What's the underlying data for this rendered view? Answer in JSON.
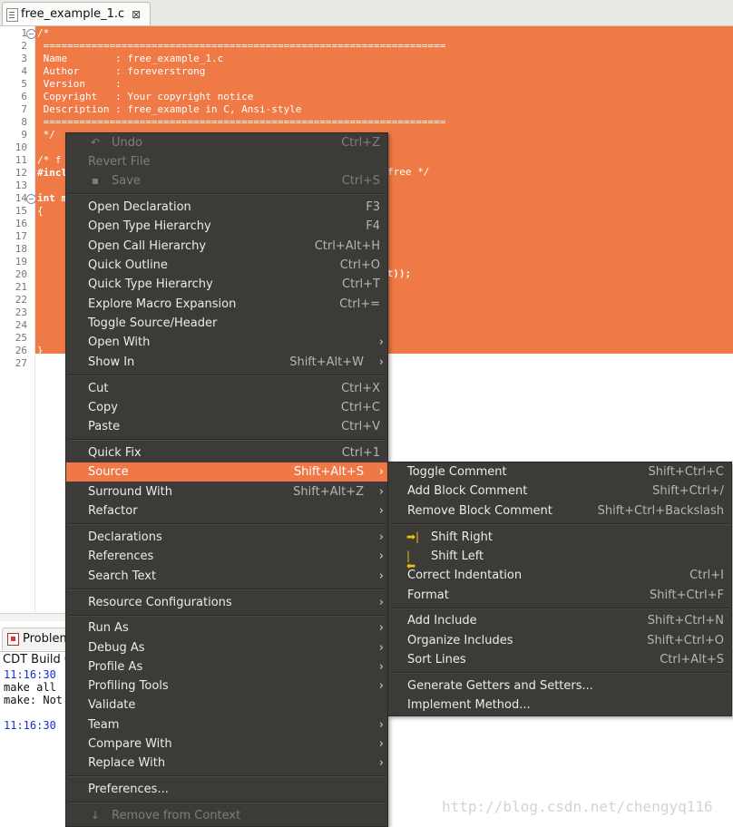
{
  "tab": {
    "title": "free_example_1.c",
    "close": "⊠"
  },
  "code": {
    "line_numbers": [
      "1",
      "2",
      "3",
      "4",
      "5",
      "6",
      "7",
      "8",
      "9",
      "10",
      "11",
      "12",
      "13",
      "14",
      "15",
      "16",
      "17",
      "18",
      "19",
      "20",
      "21",
      "22",
      "23",
      "24",
      "25",
      "26",
      "27"
    ],
    "lines": [
      "/*",
      " ===================================================================",
      " Name        : free_example_1.c",
      " Author      : foreverstrong",
      " Version     :",
      " Copyright   : Your copyright notice",
      " Description : free_example in C, Ansi-style",
      " ===================================================================",
      " */",
      "",
      "/* f",
      "#incl",
      "",
      "int m",
      "{",
      "",
      "",
      "",
      "",
      "",
      "",
      "",
      "",
      "",
      "",
      "}",
      ""
    ],
    "fragments": {
      "line12_tail": "free */",
      "line20_tail": "nt));"
    }
  },
  "problems": {
    "tab_label": "Problen",
    "header": "CDT Build C",
    "console": [
      "11:16:30",
      "make all",
      "make: Not",
      "",
      "11:16:30"
    ]
  },
  "context_menu": {
    "undo": {
      "label": "Undo",
      "shortcut": "Ctrl+Z"
    },
    "revert": {
      "label": "Revert File"
    },
    "save": {
      "label": "Save",
      "shortcut": "Ctrl+S"
    },
    "open_declaration": {
      "label": "Open Declaration",
      "shortcut": "F3"
    },
    "open_type_hierarchy": {
      "label": "Open Type Hierarchy",
      "shortcut": "F4"
    },
    "open_call_hierarchy": {
      "label": "Open Call Hierarchy",
      "shortcut": "Ctrl+Alt+H"
    },
    "quick_outline": {
      "label": "Quick Outline",
      "shortcut": "Ctrl+O"
    },
    "quick_type_hierarchy": {
      "label": "Quick Type Hierarchy",
      "shortcut": "Ctrl+T"
    },
    "explore_macro": {
      "label": "Explore Macro Expansion",
      "shortcut": "Ctrl+="
    },
    "toggle_source_header": {
      "label": "Toggle Source/Header"
    },
    "open_with": {
      "label": "Open With"
    },
    "show_in": {
      "label": "Show In",
      "shortcut": "Shift+Alt+W"
    },
    "cut": {
      "label": "Cut",
      "shortcut": "Ctrl+X"
    },
    "copy": {
      "label": "Copy",
      "shortcut": "Ctrl+C"
    },
    "paste": {
      "label": "Paste",
      "shortcut": "Ctrl+V"
    },
    "quick_fix": {
      "label": "Quick Fix",
      "shortcut": "Ctrl+1"
    },
    "source": {
      "label": "Source",
      "shortcut": "Shift+Alt+S"
    },
    "surround_with": {
      "label": "Surround With",
      "shortcut": "Shift+Alt+Z"
    },
    "refactor": {
      "label": "Refactor"
    },
    "declarations": {
      "label": "Declarations"
    },
    "references": {
      "label": "References"
    },
    "search_text": {
      "label": "Search Text"
    },
    "resource_configurations": {
      "label": "Resource Configurations"
    },
    "run_as": {
      "label": "Run As"
    },
    "debug_as": {
      "label": "Debug As"
    },
    "profile_as": {
      "label": "Profile As"
    },
    "profiling_tools": {
      "label": "Profiling Tools"
    },
    "validate": {
      "label": "Validate"
    },
    "team": {
      "label": "Team"
    },
    "compare_with": {
      "label": "Compare With"
    },
    "replace_with": {
      "label": "Replace With"
    },
    "preferences": {
      "label": "Preferences..."
    },
    "remove_from_context": {
      "label": "Remove from Context"
    }
  },
  "source_submenu": {
    "toggle_comment": {
      "label": "Toggle Comment",
      "shortcut": "Shift+Ctrl+C"
    },
    "add_block_comment": {
      "label": "Add Block Comment",
      "shortcut": "Shift+Ctrl+/"
    },
    "remove_block_comment": {
      "label": "Remove Block Comment",
      "shortcut": "Shift+Ctrl+Backslash"
    },
    "shift_right": {
      "label": "Shift Right"
    },
    "shift_left": {
      "label": "Shift Left"
    },
    "correct_indentation": {
      "label": "Correct Indentation",
      "shortcut": "Ctrl+I"
    },
    "format": {
      "label": "Format",
      "shortcut": "Shift+Ctrl+F"
    },
    "add_include": {
      "label": "Add Include",
      "shortcut": "Shift+Ctrl+N"
    },
    "organize_includes": {
      "label": "Organize Includes",
      "shortcut": "Shift+Ctrl+O"
    },
    "sort_lines": {
      "label": "Sort Lines",
      "shortcut": "Ctrl+Alt+S"
    },
    "generate_getters_setters": {
      "label": "Generate Getters and Setters..."
    },
    "implement_method": {
      "label": "Implement Method..."
    }
  },
  "watermark": "http://blog.csdn.net/chengyq116",
  "colors": {
    "selection": "#f07a46",
    "menu_bg": "#3c3b37",
    "menu_highlight": "#f07746"
  }
}
